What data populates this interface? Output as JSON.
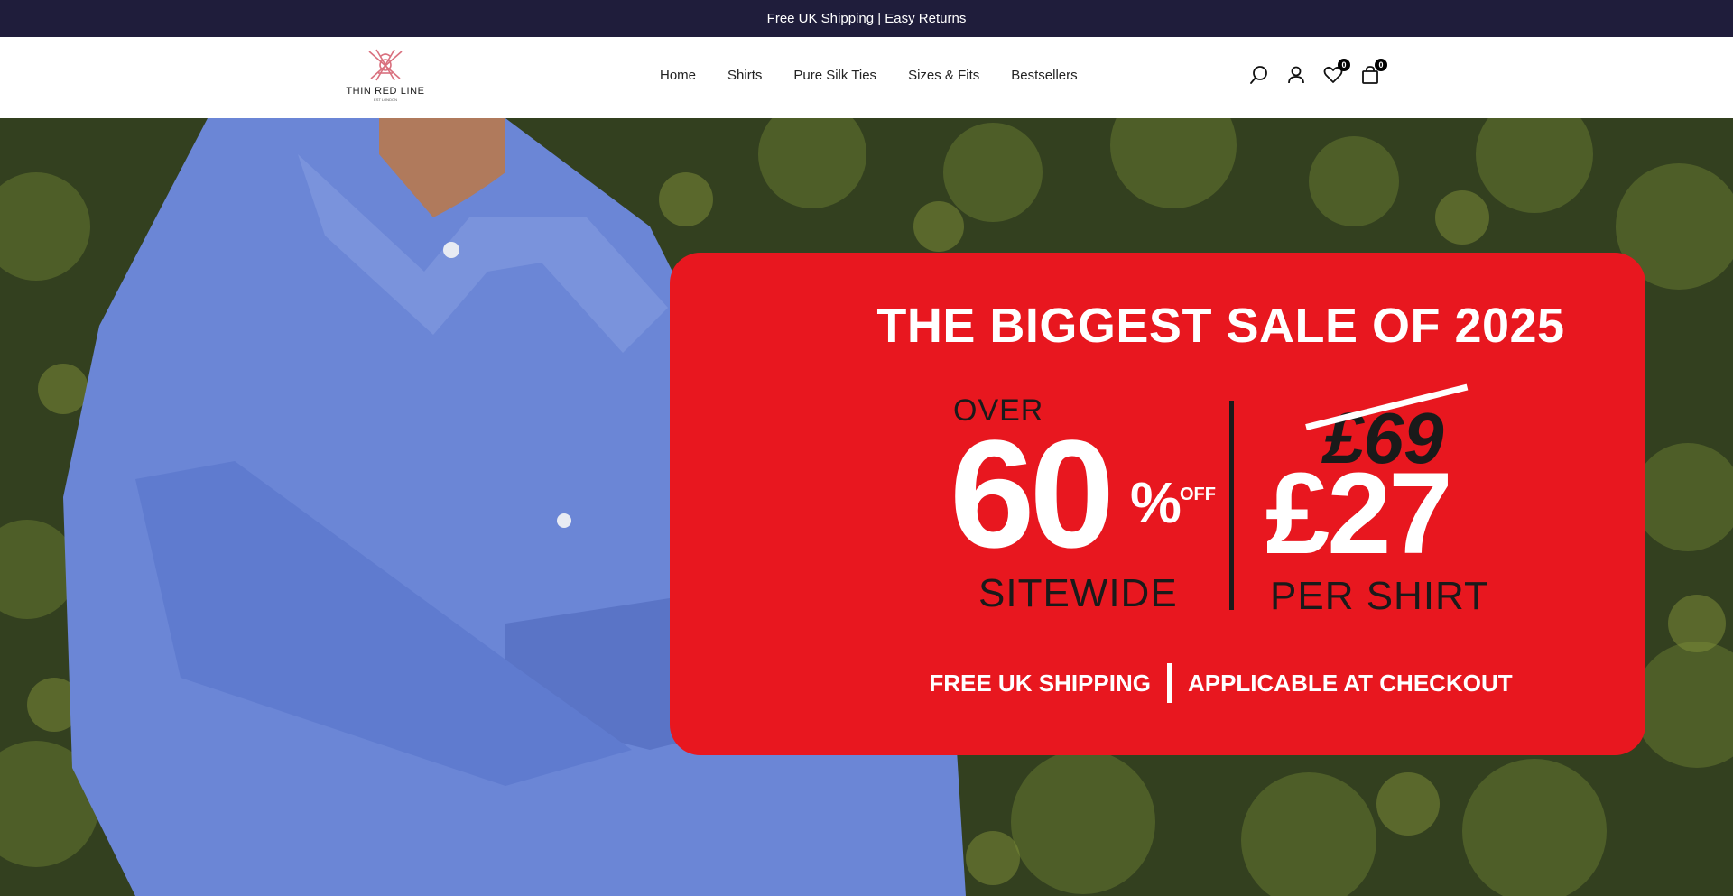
{
  "announcement": {
    "text": "Free UK Shipping | Easy Returns"
  },
  "logo": {
    "text": "THIN RED LINE",
    "subtext": "EST LONDON"
  },
  "nav": {
    "items": [
      {
        "label": "Home"
      },
      {
        "label": "Shirts"
      },
      {
        "label": "Pure Silk Ties"
      },
      {
        "label": "Sizes & Fits"
      },
      {
        "label": "Bestsellers"
      }
    ]
  },
  "header_icons": {
    "search": "search-icon",
    "account": "user-icon",
    "wishlist": {
      "icon": "heart-icon",
      "count": "0"
    },
    "cart": {
      "icon": "bag-icon",
      "count": "0"
    }
  },
  "hero": {
    "title": "THE BIGGEST SALE OF 2025",
    "over": "OVER",
    "discount": "60",
    "percent": "%",
    "off": "OFF",
    "sitewide": "SITEWIDE",
    "old_price": "£69",
    "new_price": "£27",
    "per_shirt": "PER SHIRT",
    "shipping": "FREE UK SHIPPING",
    "checkout": "APPLICABLE AT CHECKOUT",
    "banner_color": "#e8171f"
  },
  "colors": {
    "announcement_bg": "#1f1d3b",
    "accent": "#e8171f"
  }
}
